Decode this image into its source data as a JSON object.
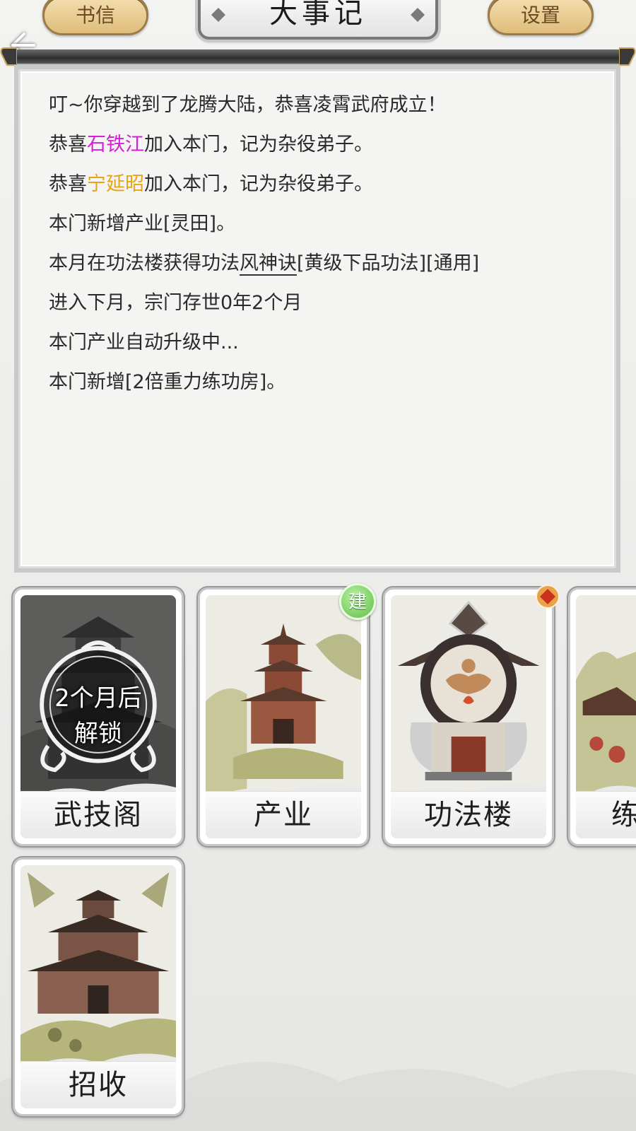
{
  "header": {
    "title": "大事记",
    "left_button": "书信",
    "right_button": "设置"
  },
  "log": {
    "lines": [
      {
        "text": "叮~你穿越到了龙腾大陆，恭喜凌霄武府成立！"
      },
      {
        "pre": "恭喜",
        "name": "石铁江",
        "name_color": "#d61ed6",
        "post": "加入本门，记为杂役弟子。"
      },
      {
        "pre": "恭喜",
        "name": "宁延昭",
        "name_color": "#e3a41a",
        "post": "加入本门，记为杂役弟子。"
      },
      {
        "text": "本门新增产业[灵田]。"
      },
      {
        "pre": "本月在功法楼获得功法",
        "skill": "风神诀",
        "post": "[黄级下品功法][通用]"
      },
      {
        "text": "进入下月，宗门存世0年2个月"
      },
      {
        "text": "本门产业自动升级中..."
      },
      {
        "text": "本门新增[2倍重力练功房]。"
      }
    ]
  },
  "buildings": [
    {
      "label": "武技阁",
      "locked": true,
      "lock_line1": "2个月后",
      "lock_line2": "解锁"
    },
    {
      "label": "产业",
      "badge": "建",
      "badge_color": "#5fbf4a"
    },
    {
      "label": "功法楼",
      "badge_icon": "red-diamond-icon"
    },
    {
      "label": "练"
    },
    {
      "label": "招收"
    }
  ]
}
